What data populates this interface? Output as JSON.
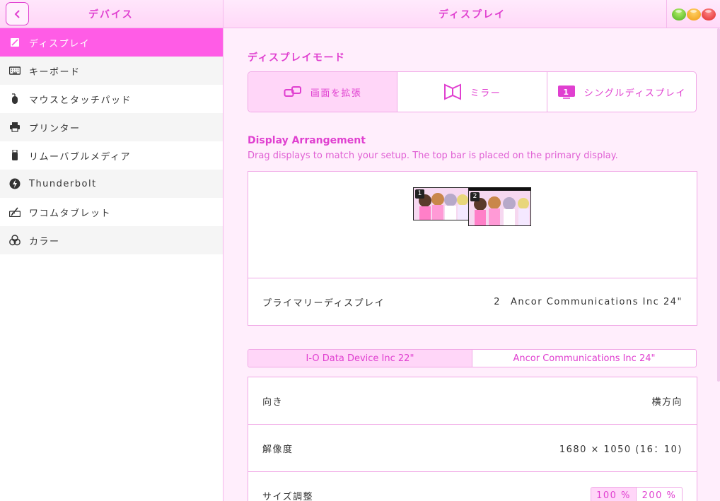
{
  "header": {
    "left_title": "デバイス",
    "right_title": "ディスプレイ"
  },
  "sidebar": {
    "items": [
      {
        "label": "ディスプレイ",
        "icon": "display-icon"
      },
      {
        "label": "キーボード",
        "icon": "keyboard-icon"
      },
      {
        "label": "マウスとタッチパッド",
        "icon": "mouse-icon"
      },
      {
        "label": "プリンター",
        "icon": "printer-icon"
      },
      {
        "label": "リムーバブルメディア",
        "icon": "usb-icon"
      },
      {
        "label": "Thunderbolt",
        "icon": "thunderbolt-icon"
      },
      {
        "label": "ワコムタブレット",
        "icon": "tablet-icon"
      },
      {
        "label": "カラー",
        "icon": "color-icon"
      }
    ]
  },
  "display_mode": {
    "title": "ディスプレイモード",
    "options": [
      {
        "label": "画面を拡張",
        "icon": "extend-icon",
        "selected": true
      },
      {
        "label": "ミラー",
        "icon": "mirror-icon",
        "selected": false
      },
      {
        "label": "シングルディスプレイ",
        "icon": "single-display-icon",
        "selected": false
      }
    ]
  },
  "arrangement": {
    "title": "Display Arrangement",
    "subtitle": "Drag displays to match your setup. The top bar is placed on the primary display.",
    "monitors": [
      {
        "number": "1"
      },
      {
        "number": "2"
      }
    ],
    "primary_label": "プライマリーディスプレイ",
    "primary_number": "2",
    "primary_value": "Ancor Communications Inc 24\""
  },
  "monitor_tabs": [
    "I-O Data Device Inc 22\"",
    "Ancor Communications Inc 24\""
  ],
  "properties": {
    "orientation_label": "向き",
    "orientation_value": "横方向",
    "resolution_label": "解像度",
    "resolution_value": "1680 × 1050 (16：10)",
    "scale_label": "サイズ調整",
    "scale_options": [
      "100 %",
      "200 %"
    ]
  },
  "colors": {
    "accent": "#e040d0",
    "active_bg": "#ff5ce6",
    "selected_bg": "#ffd6f8"
  }
}
